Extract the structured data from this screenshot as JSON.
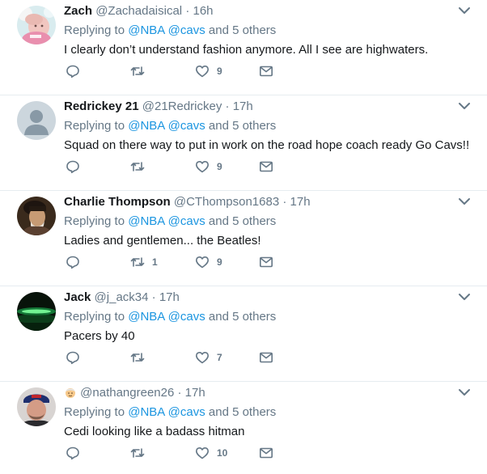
{
  "tweets": [
    {
      "display_name": "Zach",
      "handle": "@Zachadaisical",
      "separator": "·",
      "time": "16h",
      "replying_prefix": "Replying to",
      "mention_1": "@NBA",
      "mention_2": "@cavs",
      "replying_suffix": "and 5 others",
      "text": "I clearly don’t understand fashion anymore.  All I see are highwaters.",
      "reply_count": "",
      "retweet_count": "",
      "like_count": "9",
      "avatar": "baby-photo"
    },
    {
      "display_name": "Redrickey 21",
      "handle": "@21Redrickey",
      "separator": "·",
      "time": "17h",
      "replying_prefix": "Replying to",
      "mention_1": "@NBA",
      "mention_2": "@cavs",
      "replying_suffix": "and 5 others",
      "text": "Squad on there way to put in work on the road hope coach ready Go Cavs!!",
      "reply_count": "",
      "retweet_count": "",
      "like_count": "9",
      "avatar": "default-egg"
    },
    {
      "display_name": "Charlie Thompson",
      "handle": "@CThompson1683",
      "separator": "·",
      "time": "17h",
      "replying_prefix": "Replying to",
      "mention_1": "@NBA",
      "mention_2": "@cavs",
      "replying_suffix": "and 5 others",
      "text": "Ladies and gentlemen... the Beatles!",
      "reply_count": "",
      "retweet_count": "1",
      "like_count": "9",
      "avatar": "portrait-painting"
    },
    {
      "display_name": "Jack",
      "handle": "@j_ack34",
      "separator": "·",
      "time": "17h",
      "replying_prefix": "Replying to",
      "mention_1": "@NBA",
      "mention_2": "@cavs",
      "replying_suffix": "and 5 others",
      "text": "Pacers by 40",
      "reply_count": "",
      "retweet_count": "",
      "like_count": "7",
      "avatar": "green-aurora"
    },
    {
      "display_name": "",
      "handle": "@nathangreen26",
      "separator": "·",
      "time": "17h",
      "replying_prefix": "Replying to",
      "mention_1": "@NBA",
      "mention_2": "@cavs",
      "replying_suffix": "and 5 others",
      "text": "Cedi looking like a badass hitman",
      "reply_count": "",
      "retweet_count": "",
      "like_count": "10",
      "avatar": "man-with-cap",
      "name_emoji": "old-man-emoji"
    }
  ],
  "icons": {
    "reply": "reply-icon",
    "retweet": "retweet-icon",
    "like": "heart-icon",
    "message": "envelope-icon",
    "menu": "chevron-down-icon"
  },
  "colors": {
    "link": "#1b95e0",
    "secondary": "#657786",
    "text": "#14171a",
    "divider": "#e6ecf0"
  }
}
